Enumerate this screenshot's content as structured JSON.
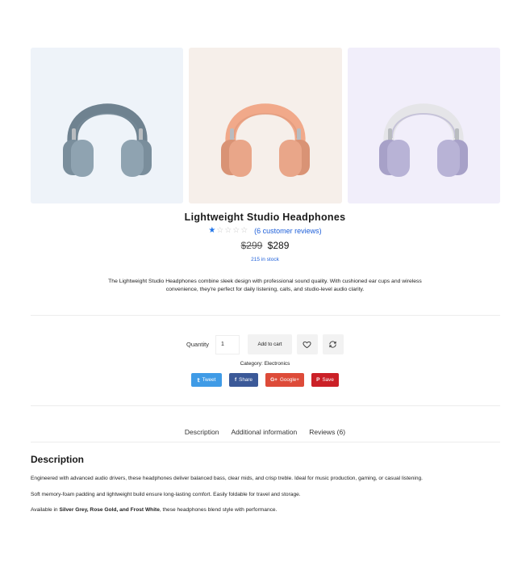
{
  "product": {
    "title": "Lightweight Studio Headphones",
    "rating_stars": 1,
    "rating_max": 5,
    "reviews_link": "(6 customer reviews)",
    "price_old": "$299",
    "price_new": "$289",
    "stock": "215 in stock",
    "description": "The Lightweight Studio Headphones combine sleek design with professional sound quality. With cushioned ear cups and wireless convenience, they're perfect for daily listening, calls, and studio-level audio clarity."
  },
  "gallery": [
    {
      "name": "silver-grey",
      "bg": "#eef3f9",
      "band": "#6f8290",
      "cup": "#8fa3b1",
      "cup_dark": "#7a8e9c"
    },
    {
      "name": "rose-gold",
      "bg": "#f6efea",
      "band": "#f1a98a",
      "cup": "#e9a689",
      "cup_dark": "#d99375"
    },
    {
      "name": "frost-white",
      "bg": "#f1eefa",
      "band": "#e5e5e8",
      "cup": "#b8b3d6",
      "cup_dark": "#a7a1c8"
    }
  ],
  "cart": {
    "quantity_label": "Quantity",
    "quantity_value": "1",
    "add_to_cart_label": "Add to cart",
    "wishlist_icon": "heart-icon",
    "compare_icon": "refresh-icon"
  },
  "category_text": "Category: Electronics",
  "share": [
    {
      "label": "Tweet",
      "icon": "twitter-icon",
      "glyph": "𝕥",
      "color": "#3f9be6"
    },
    {
      "label": "Share",
      "icon": "facebook-icon",
      "glyph": "f",
      "color": "#3b5998"
    },
    {
      "label": "Google+",
      "icon": "google-plus-icon",
      "glyph": "G+",
      "color": "#dd4b39"
    },
    {
      "label": "Save",
      "icon": "pinterest-icon",
      "glyph": "P",
      "color": "#cb2027"
    }
  ],
  "tabs": [
    "Description",
    "Additional information",
    "Reviews (6)"
  ],
  "description_section": {
    "title": "Description",
    "p1": "Engineered with advanced audio drivers, these headphones deliver balanced bass, clear mids, and crisp treble. Ideal for music production, gaming, or casual listening.",
    "p2": "Soft memory-foam padding and lightweight build ensure long-lasting comfort. Easily foldable for travel and storage.",
    "p3_prefix": "Available in ",
    "p3_bold": "Silver Grey, Rose Gold, and Frost White",
    "p3_suffix": ", these headphones blend style with performance."
  }
}
